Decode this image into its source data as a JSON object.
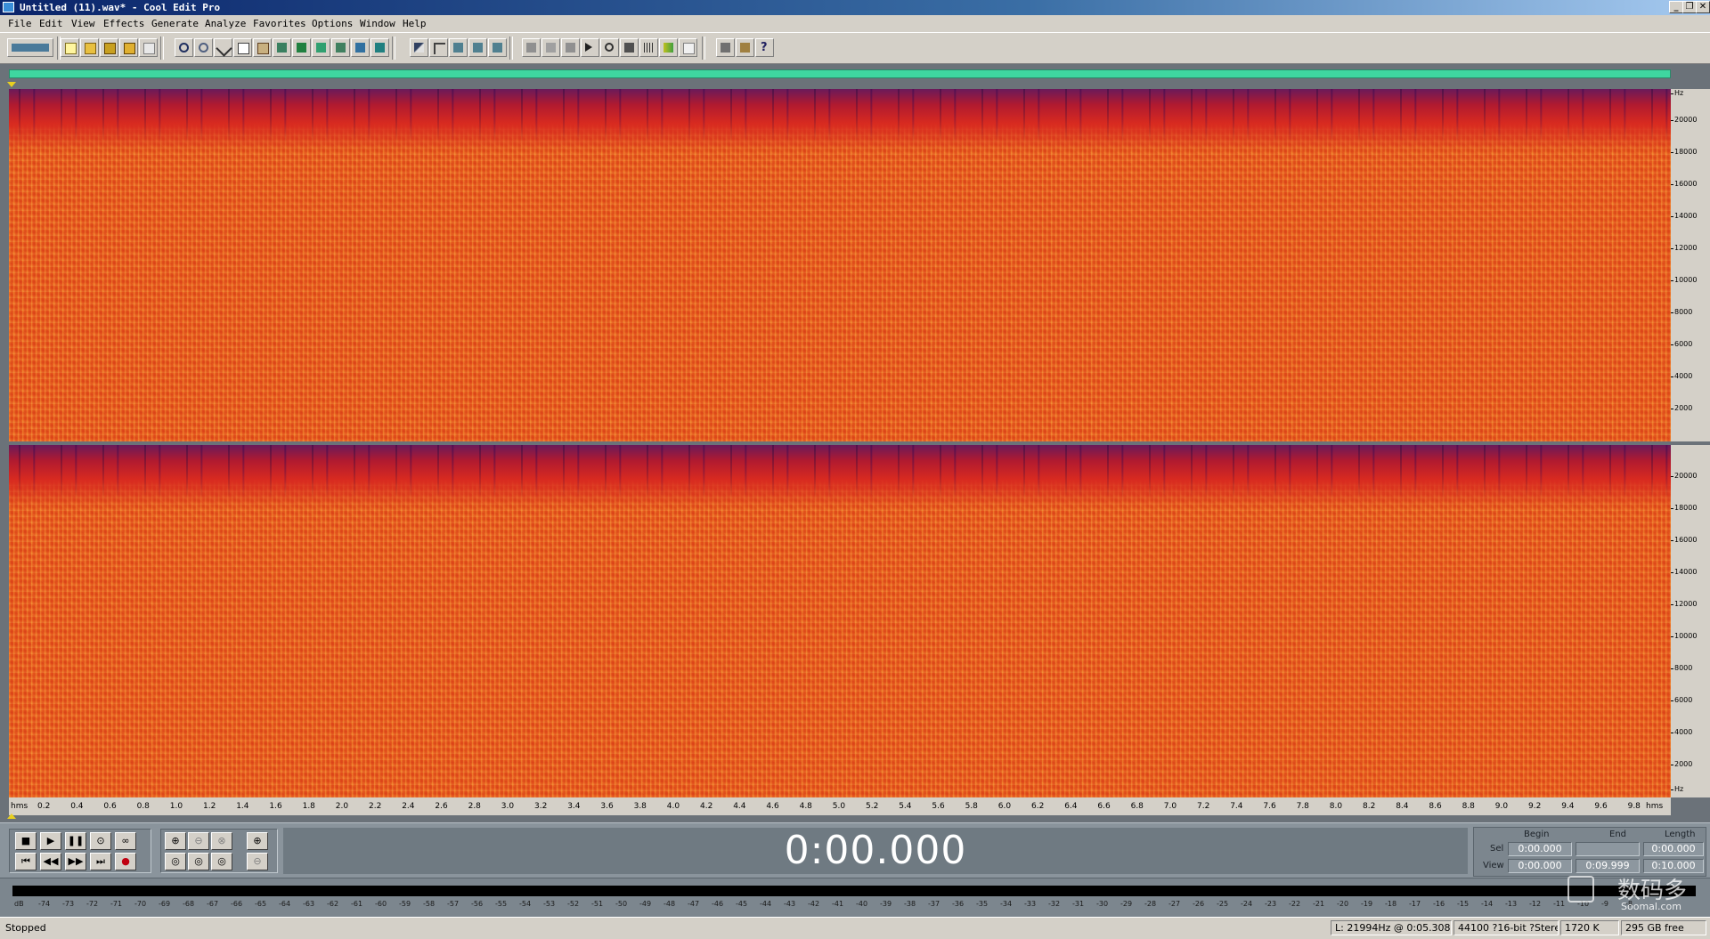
{
  "window": {
    "title": "Untitled (11).wav* - Cool Edit Pro"
  },
  "menu": [
    "File",
    "Edit",
    "View",
    "Effects",
    "Generate",
    "Analyze",
    "Favorites",
    "Options",
    "Window",
    "Help"
  ],
  "toolbar_icons": [
    "multitrack-toggle-icon",
    "new-file-icon",
    "open-file-icon",
    "save-icon",
    "save-all-icon",
    "close-icon",
    "undo-icon",
    "redo-icon",
    "cut-icon",
    "copy-icon",
    "paste-icon",
    "mix-paste-icon",
    "trim-icon",
    "insert-cue-icon",
    "loop-icon",
    "snap-icon",
    "scroll-icon",
    "envelope-icon",
    "fade-icon",
    "channel-left-icon",
    "channel-right-icon",
    "channel-both-icon",
    "waveform-view-icon",
    "spectral-view-icon",
    "frequency-analysis-icon",
    "play-icon",
    "zoom-icon",
    "time-format-icon",
    "grid-icon",
    "sample-rate-icon",
    "cue-list-icon",
    "options-icon",
    "properties-icon",
    "help-icon"
  ],
  "freq_scale": {
    "unit": "Hz",
    "ticks": [
      "20000",
      "18000",
      "16000",
      "14000",
      "12000",
      "10000",
      "8000",
      "6000",
      "4000",
      "2000"
    ]
  },
  "time_ruler": {
    "unit_left": "hms",
    "unit_right": "hms",
    "labels": [
      "0.2",
      "0.4",
      "0.6",
      "0.8",
      "1.0",
      "1.2",
      "1.4",
      "1.6",
      "1.8",
      "2.0",
      "2.2",
      "2.4",
      "2.6",
      "2.8",
      "3.0",
      "3.2",
      "3.4",
      "3.6",
      "3.8",
      "4.0",
      "4.2",
      "4.4",
      "4.6",
      "4.8",
      "5.0",
      "5.2",
      "5.4",
      "5.6",
      "5.8",
      "6.0",
      "6.2",
      "6.4",
      "6.6",
      "6.8",
      "7.0",
      "7.2",
      "7.4",
      "7.6",
      "7.8",
      "8.0",
      "8.2",
      "8.4",
      "8.6",
      "8.8",
      "9.0",
      "9.2",
      "9.4",
      "9.6",
      "9.8"
    ]
  },
  "transport": {
    "time": "0:00.000"
  },
  "selection": {
    "header_begin": "Begin",
    "header_end": "End",
    "header_length": "Length",
    "sel_label": "Sel",
    "view_label": "View",
    "sel_begin": "0:00.000",
    "sel_end": "",
    "sel_length": "0:00.000",
    "view_begin": "0:00.000",
    "view_end": "0:09.999",
    "view_length": "0:10.000"
  },
  "level_meter": {
    "labels": [
      "dB",
      "-74",
      "-73",
      "-72",
      "-71",
      "-70",
      "-69",
      "-68",
      "-67",
      "-66",
      "-65",
      "-64",
      "-63",
      "-62",
      "-61",
      "-60",
      "-59",
      "-58",
      "-57",
      "-56",
      "-55",
      "-54",
      "-53",
      "-52",
      "-51",
      "-50",
      "-49",
      "-48",
      "-47",
      "-46",
      "-45",
      "-44",
      "-43",
      "-42",
      "-41",
      "-40",
      "-39",
      "-38",
      "-37",
      "-36",
      "-35",
      "-34",
      "-33",
      "-32",
      "-31",
      "-30",
      "-29",
      "-28",
      "-27",
      "-26",
      "-25",
      "-24",
      "-23",
      "-22",
      "-21",
      "-20",
      "-19",
      "-18",
      "-17",
      "-16",
      "-15",
      "-14",
      "-13",
      "-12",
      "-11",
      "-10",
      "-9",
      "-8"
    ]
  },
  "status": {
    "state": "Stopped",
    "cursor": "L: 21994Hz @   0:05.308",
    "format": "44100 ?16-bit ?Stereo",
    "size": "1720 K",
    "free": "295 GB free"
  },
  "watermark": {
    "text_cn": "数码多",
    "text_en": "Soomal.com"
  },
  "colors": {
    "overview": "#3fd6a0",
    "spectrum": "#e85a1c",
    "titlebar": "#0a246a"
  }
}
